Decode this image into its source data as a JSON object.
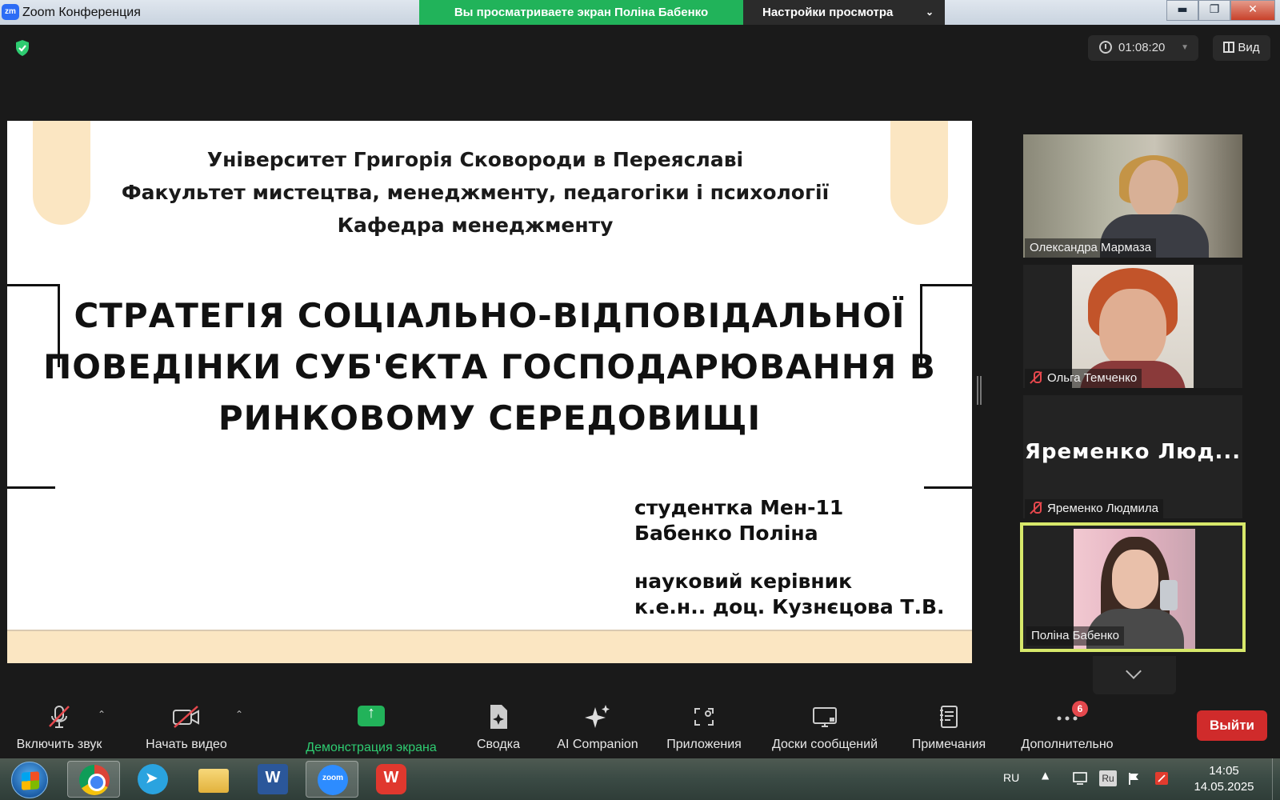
{
  "window": {
    "app_logo": "zm",
    "title": "Zoom Конференция",
    "viewing_banner": "Вы просматриваете экран Поліна Бабенко",
    "view_settings": "Настройки просмотра",
    "controls": {
      "minimize": "▬",
      "maximize": "❐",
      "close": "✕"
    }
  },
  "meeting": {
    "security_icon": "shield-check-icon",
    "timer": "01:08:20",
    "view_label": "Вид"
  },
  "slide": {
    "institution_lines": [
      "Університет Григорія Сковороди в Переяславі",
      "Факультет мистецтва, менеджменту, педагогіки і психології",
      "Кафедра менеджменту"
    ],
    "title_lines": [
      "СТРАТЕГІЯ СОЦІАЛЬНО-ВІДПОВІДАЛЬНОЇ",
      "ПОВЕДІНКИ СУБ'ЄКТА ГОСПОДАРЮВАННЯ В",
      "РИНКОВОМУ СЕРЕДОВИЩІ"
    ],
    "author_lines": [
      "студентка Мен-11",
      "Бабенко Поліна"
    ],
    "supervisor_lines": [
      "науковий керівник",
      "к.е.н.. доц. Кузнєцова Т.В."
    ],
    "accent_color": "#fbe6c2"
  },
  "participants": [
    {
      "name": "Олександра Мармаза",
      "muted": false
    },
    {
      "name": "Ольга Темченко",
      "muted": true
    },
    {
      "name": "Яременко Людмила",
      "display_text": "Яременко Люд...",
      "muted": true
    },
    {
      "name": "Поліна Бабенко",
      "muted": false,
      "active_speaker": true
    }
  ],
  "toolbar": {
    "unmute": "Включить звук",
    "start_video": "Начать видео",
    "share_screen": "Демонстрация экрана",
    "summary": "Сводка",
    "ai_companion": "AI Companion",
    "apps": "Приложения",
    "whiteboards": "Доски сообщений",
    "notes": "Примечания",
    "more": "Дополнительно",
    "more_badge": "6",
    "leave": "Выйти",
    "share_color": "#22b35a",
    "leave_color": "#d02b2b"
  },
  "taskbar": {
    "apps": [
      "chrome",
      "telegram",
      "file-explorer",
      "word",
      "zoom",
      "wps-office"
    ],
    "language": "RU",
    "input_indicator": "Ru",
    "time": "14:05",
    "date": "14.05.2025"
  }
}
